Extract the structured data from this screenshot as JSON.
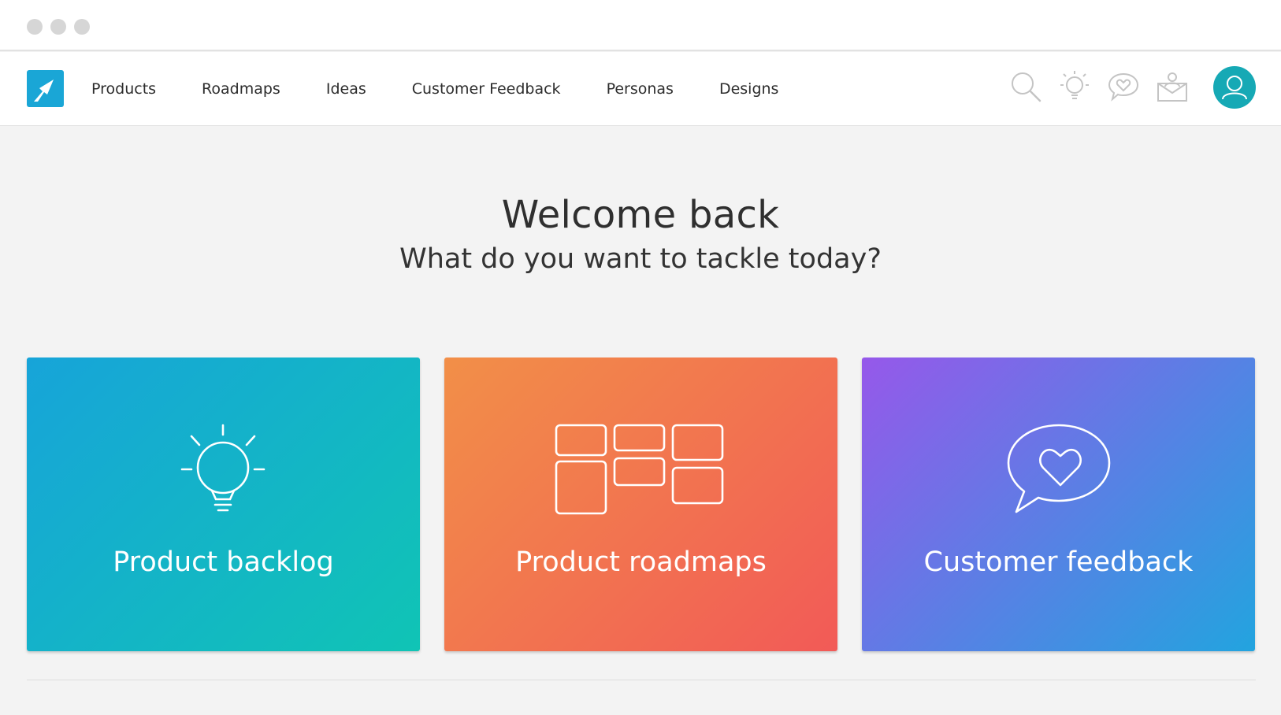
{
  "window": {
    "controls": [
      "close-dot",
      "minimize-dot",
      "maximize-dot"
    ]
  },
  "nav": {
    "logo_icon": "arrow-up-right-icon",
    "items": [
      {
        "label": "Products"
      },
      {
        "label": "Roadmaps"
      },
      {
        "label": "Ideas"
      },
      {
        "label": "Customer Feedback"
      },
      {
        "label": "Personas"
      },
      {
        "label": "Designs"
      }
    ],
    "icons": [
      "search-icon",
      "lightbulb-icon",
      "chat-heart-icon",
      "inbox-user-icon"
    ],
    "avatar_icon": "user-icon"
  },
  "welcome": {
    "title": "Welcome back",
    "subtitle": "What do you want to tackle today?"
  },
  "cards": [
    {
      "label": "Product backlog",
      "icon": "lightbulb-icon"
    },
    {
      "label": "Product roadmaps",
      "icon": "roadmap-grid-icon"
    },
    {
      "label": "Customer feedback",
      "icon": "chat-heart-icon"
    }
  ],
  "colors": {
    "brand": "#1aa6d6",
    "avatar": "#16a9b5",
    "backlog_gradient": [
      "#17a4d9",
      "#10c4b5"
    ],
    "roadmaps_gradient": [
      "#f28f48",
      "#f25a57"
    ],
    "feedback_gradient": [
      "#9658ea",
      "#22a4df"
    ]
  }
}
